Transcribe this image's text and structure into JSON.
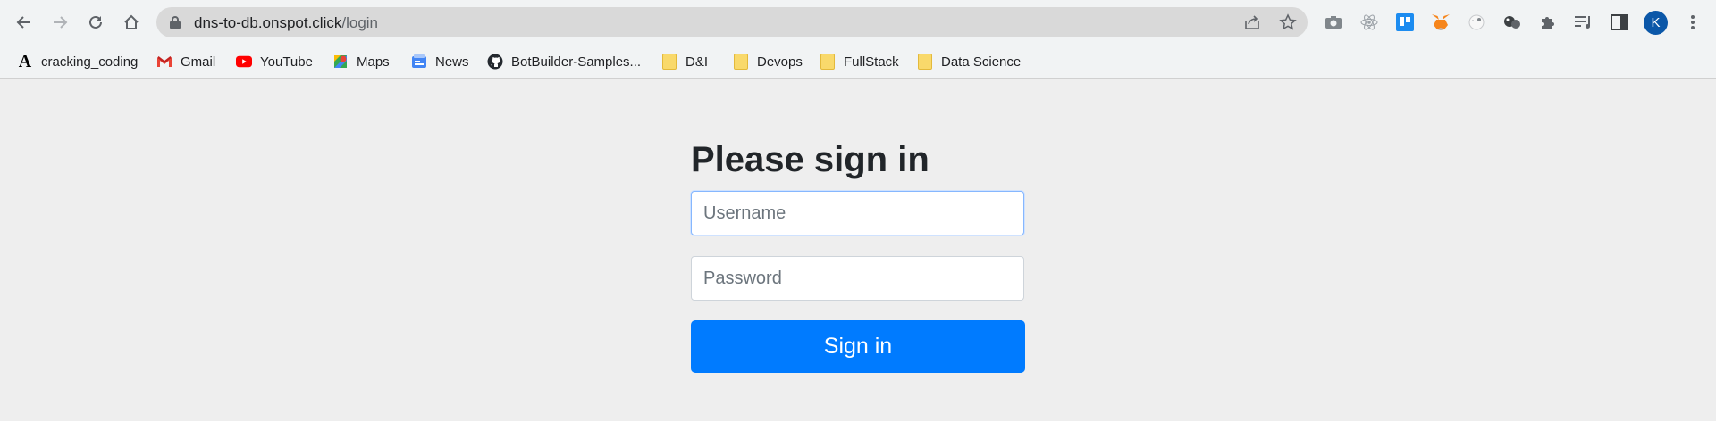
{
  "browser": {
    "url_host": "dns-to-db.onspot.click",
    "url_path": "/login",
    "avatar_initial": "K",
    "nav_icons": [
      "back-icon",
      "forward-icon",
      "reload-icon",
      "home-icon"
    ],
    "extension_icons": [
      "camera-icon",
      "react-icon",
      "trello-icon",
      "metamask-icon",
      "extension-icon",
      "extension-icon",
      "puzzle-icon",
      "media-control-icon",
      "side-panel-icon"
    ]
  },
  "bookmarks": [
    {
      "label": "cracking_coding",
      "icon": "letter-a-icon"
    },
    {
      "label": "Gmail",
      "icon": "gmail-icon"
    },
    {
      "label": "YouTube",
      "icon": "youtube-icon"
    },
    {
      "label": "Maps",
      "icon": "maps-icon"
    },
    {
      "label": "News",
      "icon": "news-icon"
    },
    {
      "label": "BotBuilder-Samples...",
      "icon": "github-icon"
    },
    {
      "label": "D&I",
      "icon": "folder-icon"
    },
    {
      "label": "Devops",
      "icon": "folder-icon"
    },
    {
      "label": "FullStack",
      "icon": "folder-icon"
    },
    {
      "label": "Data Science",
      "icon": "folder-icon"
    }
  ],
  "login": {
    "title": "Please sign in",
    "username_placeholder": "Username",
    "password_placeholder": "Password",
    "submit_label": "Sign in"
  },
  "colors": {
    "page_background": "#eeeeee",
    "primary_button": "#007bff",
    "chrome_background": "#f1f3f4"
  }
}
